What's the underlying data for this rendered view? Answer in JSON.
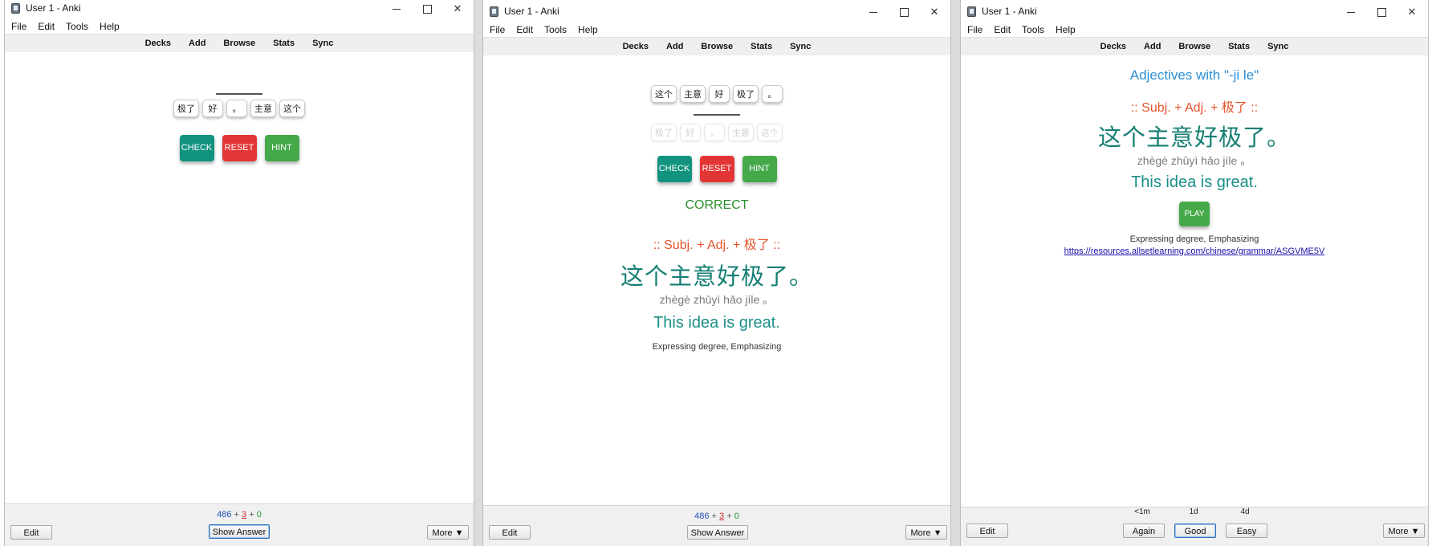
{
  "colors": {
    "check": "#12937f",
    "reset": "#e23636",
    "hint": "#45a94a",
    "pattern": "#e5532b",
    "hanzi": "#167f74",
    "english": "#1a8f88",
    "correct": "#2f8f2f",
    "title": "#2c8ed4",
    "link": "#1a0dab"
  },
  "icons": [
    "anki-app-icon",
    "minimize-icon",
    "maximize-icon",
    "close-icon",
    "triangle-down-icon"
  ],
  "window": {
    "title": "User 1 - Anki",
    "controls": {
      "minimize": "",
      "maximize": "",
      "close": "✕"
    }
  },
  "menu": [
    "File",
    "Edit",
    "Tools",
    "Help"
  ],
  "toolbar": [
    "Decks",
    "Add",
    "Browse",
    "Stats",
    "Sync"
  ],
  "counts": {
    "new": "486",
    "learn": "3",
    "review": "0",
    "plus": "+"
  },
  "bottom": {
    "edit": "Edit",
    "show_answer": "Show Answer",
    "more": "More"
  },
  "panel1": {
    "tiles": [
      "极了",
      "好",
      "。",
      "主意",
      "这个"
    ]
  },
  "panel2": {
    "tiles": [
      "这个",
      "主意",
      "好",
      "极了",
      "。"
    ],
    "ghost_tiles": [
      "极了",
      "好",
      "。",
      "主意",
      "这个"
    ],
    "status": "CORRECT"
  },
  "buttons": {
    "check": "CHECK",
    "reset": "RESET",
    "hint": "HINT",
    "play": "PLAY"
  },
  "card": {
    "pattern": ":: Subj. + Adj. + 极了 ::",
    "hanzi": "这个主意好极了。",
    "pinyin": "zhègè zhǔyì hǎo jíle 。",
    "english": "This idea is great.",
    "meaning": "Expressing degree, Emphasizing"
  },
  "panel3": {
    "title": "Adjectives with \"-ji le\"",
    "link": "https://resources.allsetlearning.com/chinese/grammar/ASGVME5V",
    "answer_buttons": [
      {
        "interval": "<1m",
        "label": "Again"
      },
      {
        "interval": "1d",
        "label": "Good"
      },
      {
        "interval": "4d",
        "label": "Easy"
      }
    ]
  }
}
